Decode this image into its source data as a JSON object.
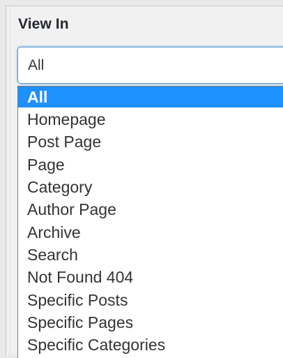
{
  "field": {
    "label": "View In"
  },
  "select": {
    "selected_value": "All"
  },
  "dropdown": {
    "options": [
      "All",
      "Homepage",
      "Post Page",
      "Page",
      "Category",
      "Author Page",
      "Archive",
      "Search",
      "Not Found 404",
      "Specific Posts",
      "Specific Pages",
      "Specific Categories"
    ],
    "highlighted_index": 0
  },
  "colors": {
    "highlight": "#1e90ff",
    "focus_border": "#5b9dd9",
    "label_text": "#23282d",
    "option_text": "#333333"
  }
}
